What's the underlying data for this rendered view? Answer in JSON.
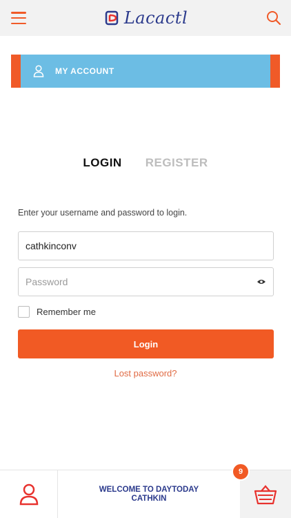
{
  "header": {
    "logo_text": "Lacactl"
  },
  "account_bar": {
    "label": "MY ACCOUNT"
  },
  "tabs": [
    {
      "label": "LOGIN",
      "active": true
    },
    {
      "label": "REGISTER",
      "active": false
    }
  ],
  "form": {
    "hint": "Enter your username and password to login.",
    "username_value": "cathkinconv",
    "password_placeholder": "Password",
    "remember_label": "Remember me",
    "login_label": "Login",
    "lost_password": "Lost password?"
  },
  "bottom_bar": {
    "welcome_line1": "WELCOME TO DAYTODAY",
    "welcome_line2": "CATHKIN",
    "cart_count": "9"
  },
  "colors": {
    "accent": "#f15a24",
    "brand_blue": "#2b3a8c",
    "account_blue": "#6cbde4"
  },
  "icons": [
    "menu-icon",
    "search-icon",
    "user-icon",
    "eye-icon",
    "profile-icon",
    "basket-icon"
  ]
}
